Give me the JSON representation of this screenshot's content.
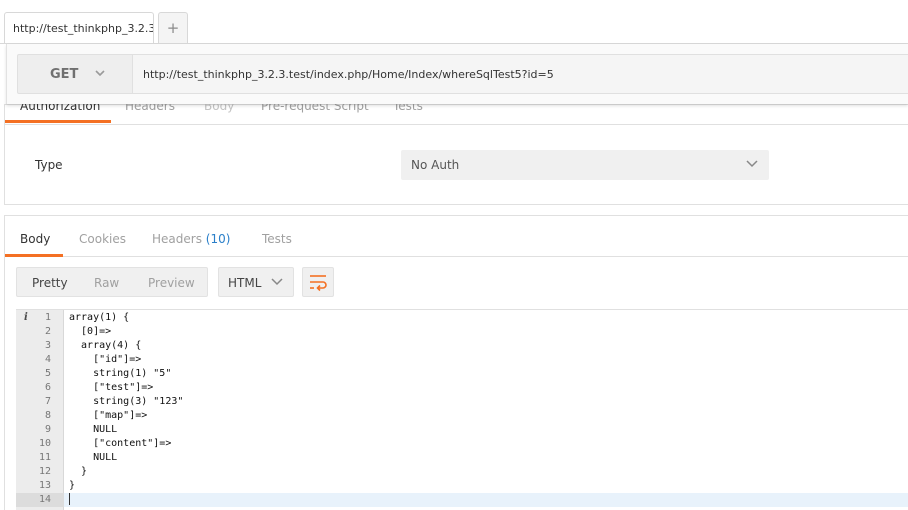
{
  "tabs": {
    "request_tab_label": "http://test_thinkphp_3.2.3",
    "add_tab_label": "+"
  },
  "request": {
    "method": "GET",
    "url": "http://test_thinkphp_3.2.3.test/index.php/Home/Index/whereSqlTest5?id=5"
  },
  "request_tabs": [
    "Authorization",
    "Headers",
    "Body",
    "Pre-request Script",
    "Tests"
  ],
  "auth": {
    "type_label": "Type",
    "selected": "No Auth"
  },
  "response_tabs": {
    "body": "Body",
    "cookies": "Cookies",
    "headers": "Headers",
    "headers_count": "(10)",
    "tests": "Tests"
  },
  "view_modes": [
    "Pretty",
    "Raw",
    "Preview"
  ],
  "language": "HTML",
  "icons": {
    "method_chevron": "chevron-down-icon",
    "auth_chevron": "chevron-down-icon",
    "language_chevron": "chevron-down-icon",
    "wrap": "wrap-lines-icon",
    "gutter_info": "info-icon"
  },
  "colors": {
    "accent": "#f47023",
    "count": "#2a7fc9"
  },
  "editor": {
    "info_marker": "i",
    "lines": [
      "array(1) {",
      "  [0]=>",
      "  array(4) {",
      "    [\"id\"]=>",
      "    string(1) \"5\"",
      "    [\"test\"]=>",
      "    string(3) \"123\"",
      "    [\"map\"]=>",
      "    NULL",
      "    [\"content\"]=>",
      "    NULL",
      "  }",
      "}",
      ""
    ],
    "current_line": 14
  }
}
